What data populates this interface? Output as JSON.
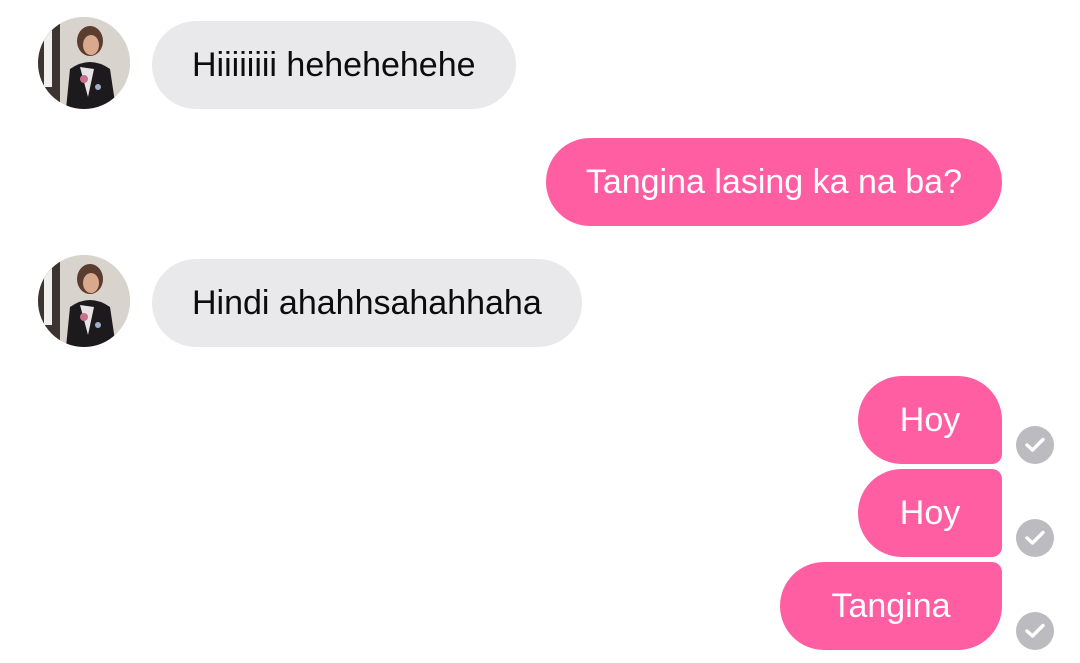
{
  "conversation": {
    "messages": [
      {
        "sender": "contact",
        "text": "Hiiiiiiii hehehehehe"
      },
      {
        "sender": "me",
        "text": "Tangina lasing ka na ba?"
      },
      {
        "sender": "contact",
        "text": "Hindi ahahhsahahhaha"
      },
      {
        "sender": "me",
        "text": "Hoy",
        "status": "sent-check-icon"
      },
      {
        "sender": "me",
        "text": "Hoy",
        "status": "sent-check-icon"
      },
      {
        "sender": "me",
        "text": "Tangina",
        "status": "sent-check-icon"
      }
    ]
  },
  "colors": {
    "outgoing_bubble": "#ff5ea3",
    "incoming_bubble": "#e9e9eb",
    "read_check": "#bcbcc0"
  }
}
